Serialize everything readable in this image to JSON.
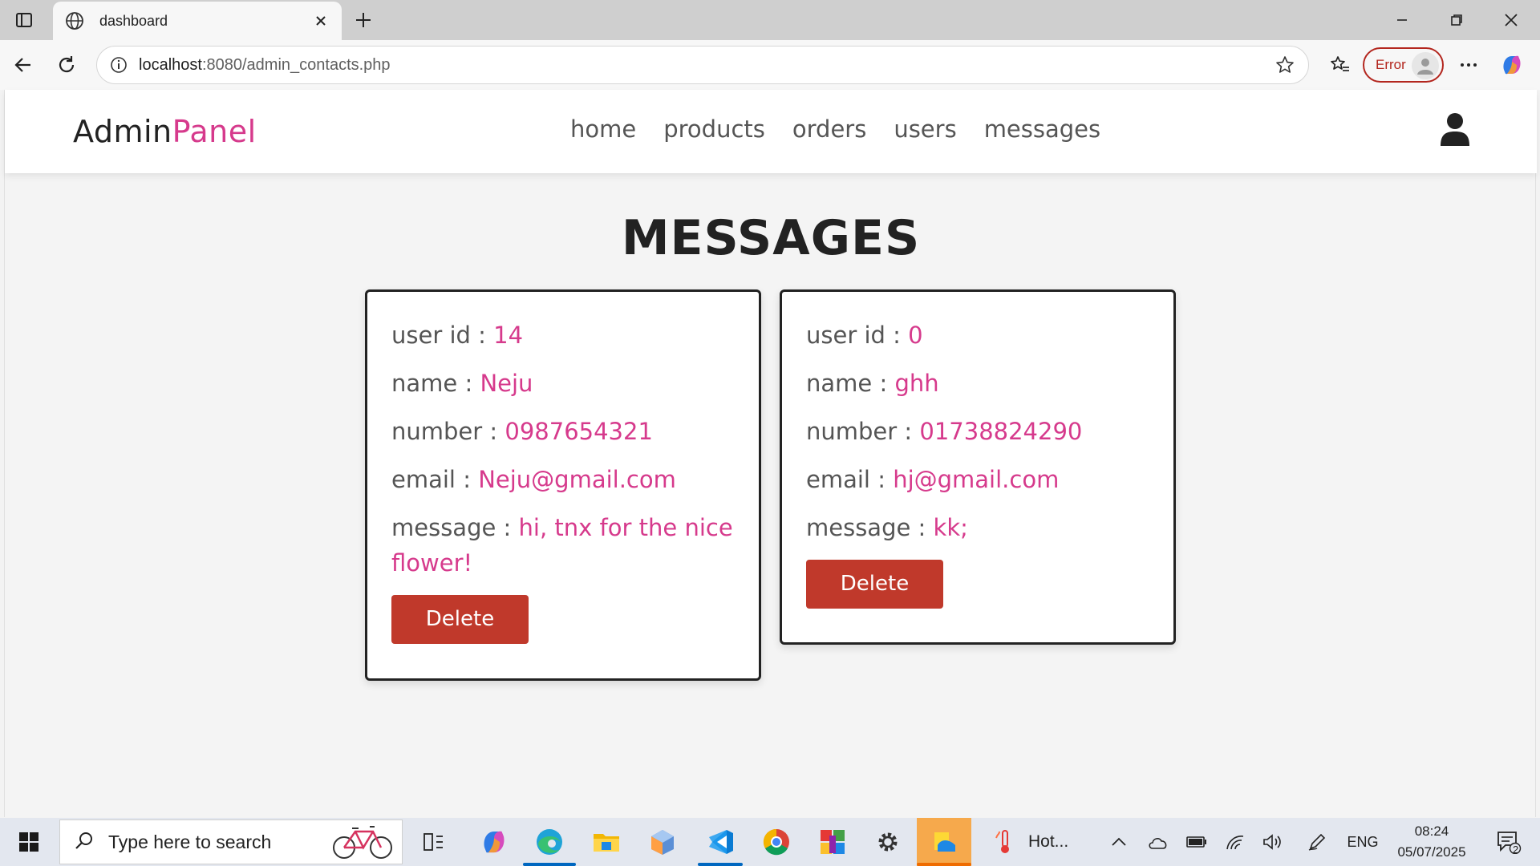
{
  "browser": {
    "tab_title": "dashboard",
    "url_host": "localhost",
    "url_path": ":8080/admin_contacts.php",
    "error_label": "Error"
  },
  "site": {
    "logo_main": "Admin",
    "logo_accent": "Panel",
    "nav": [
      "home",
      "products",
      "orders",
      "users",
      "messages"
    ],
    "page_title": "MESSAGES",
    "accent_color": "#d63a8c",
    "delete_color": "#c0392b"
  },
  "messages": [
    {
      "user_id_label": "user id : ",
      "user_id": "14",
      "name_label": "name : ",
      "name": "Neju",
      "number_label": "number : ",
      "number": "0987654321",
      "email_label": "email : ",
      "email": "Neju@gmail.com",
      "message_label": "message : ",
      "message": "hi, tnx for the nice flower!",
      "delete_label": "Delete"
    },
    {
      "user_id_label": "user id : ",
      "user_id": "0",
      "name_label": "name : ",
      "name": "ghh",
      "number_label": "number : ",
      "number": "01738824290",
      "email_label": "email : ",
      "email": "hj@gmail.com",
      "message_label": "message : ",
      "message": "kk;",
      "delete_label": "Delete"
    }
  ],
  "taskbar": {
    "search_placeholder": "Type here to search",
    "hot_label": "Hot...",
    "lang": "ENG",
    "time": "08:24",
    "date": "05/07/2025",
    "notif_count": "2"
  }
}
